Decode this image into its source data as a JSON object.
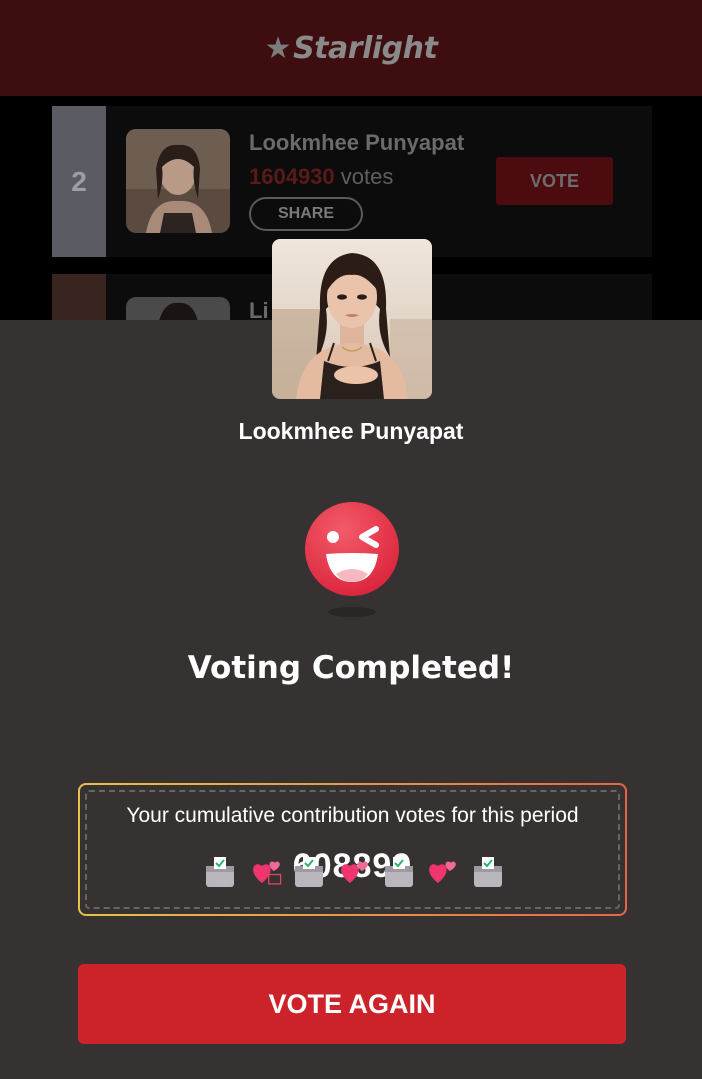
{
  "header": {
    "logo_text": "Starlight",
    "logo_icon": "star-icon"
  },
  "list": [
    {
      "rank": "2",
      "name": "Lookmhee Punyapat",
      "votes_number": "1604930",
      "votes_suffix": " votes",
      "share_label": "SHARE",
      "vote_label": "VOTE"
    },
    {
      "rank": "",
      "name": "Li"
    }
  ],
  "modal": {
    "candidate_name": "Lookmhee Punyapat",
    "title": "Voting Completed!",
    "contribution_label": "Your cumulative contribution votes for this period",
    "contribution_value": "608899",
    "vote_again_label": "VOTE AGAIN",
    "icons": [
      "winking-face-icon",
      "ballot-box-icon",
      "hearts-icon"
    ]
  },
  "colors": {
    "header_bg": "#3d0d10",
    "modal_bg": "#373232",
    "accent_red": "#cc2229",
    "votes_number_color": "#5a1a1a"
  }
}
